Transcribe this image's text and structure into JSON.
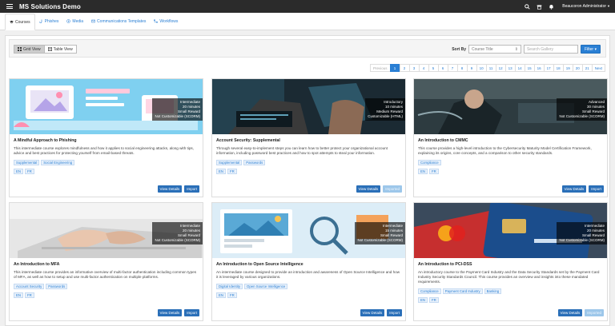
{
  "app": {
    "title": "MS Solutions Demo",
    "user": "Beaucoron Administrator"
  },
  "tabs": [
    {
      "label": "Courses",
      "icon": "graduation-cap-icon"
    },
    {
      "label": "Phishes",
      "icon": "hook-icon"
    },
    {
      "label": "Media",
      "icon": "media-icon"
    },
    {
      "label": "Communications Templates",
      "icon": "envelope-icon"
    },
    {
      "label": "Workflows",
      "icon": "workflow-icon"
    }
  ],
  "toolbar": {
    "grid_view": "Grid View",
    "table_view": "Table View",
    "sort_by": "Sort By",
    "sort_value": "Course Title",
    "search_placeholder": "Search Gallery",
    "filter": "Filter"
  },
  "pagination": {
    "previous": "Previous",
    "next": "Next",
    "pages": [
      "1",
      "2",
      "3",
      "4",
      "5",
      "6",
      "7",
      "8",
      "9",
      "10",
      "11",
      "12",
      "13",
      "14",
      "15",
      "16",
      "17",
      "18",
      "19",
      "20",
      "21"
    ],
    "active": "1"
  },
  "courses": [
    {
      "title": "A Mindful Approach to Phishing",
      "level": "Intermediate",
      "duration": "20 minutes",
      "reward": "Small Reward",
      "custom": "Not Customizable (SCORM)",
      "desc": "This intermediate course explores mindfulness and how it applies to social engineering attacks, along with tips, advice and best practices for protecting yourself from email-based threats.",
      "tags": [
        "Supplemental",
        "Social Engineering"
      ],
      "langs": [
        "EN",
        "FR"
      ],
      "details": "View Details",
      "import": "Import",
      "import_disabled": false
    },
    {
      "title": "Account Security: Supplemental",
      "level": "Introductory",
      "duration": "10 minutes",
      "reward": "Medium Reward",
      "custom": "Customizable (HTML)",
      "desc": "Through several easy-to-implement steps you can learn how to better protect your organizational account information, including password best practices and how to spot attempts to steal your information.",
      "tags": [
        "Supplemental",
        "Passwords"
      ],
      "langs": [
        "EN",
        "FR"
      ],
      "details": "View Details",
      "import": "Imported",
      "import_disabled": true
    },
    {
      "title": "An Introduction to CMMC",
      "level": "Advanced",
      "duration": "30 minutes",
      "reward": "Small Reward",
      "custom": "Not Customizable (SCORM)",
      "desc": "This course provides a high-level introduction to the Cybersecurity Maturity Model Certification Framework, explaining its origins, core concepts, and a comparison to other security standards.",
      "tags": [
        "Compliance"
      ],
      "langs": [
        "EN",
        "FR"
      ],
      "details": "View Details",
      "import": "Import",
      "import_disabled": false
    },
    {
      "title": "An Introduction to MFA",
      "level": "Intermediate",
      "duration": "20 minutes",
      "reward": "Small Reward",
      "custom": "Not Customizable (SCORM)",
      "desc": "This intermediate course provides an informative overview of multi-factor authentication including common types of MFA, as well as how to setup and use multi-factor authentication on multiple platforms.",
      "tags": [
        "Account Security",
        "Passwords"
      ],
      "langs": [
        "EN",
        "FR"
      ],
      "details": "View Details",
      "import": "Import",
      "import_disabled": false
    },
    {
      "title": "An Introduction to Open Source Intelligence",
      "level": "Intermediate",
      "duration": "15 minutes",
      "reward": "Small Reward",
      "custom": "Not Customizable (SCORM)",
      "desc": "An intermediate course designed to provide an introduction and awareness of Open Source Intelligence and how it is leveraged by various organizations.",
      "tags": [
        "Digital Identity",
        "Open Source Intelligence"
      ],
      "langs": [
        "EN",
        "FR"
      ],
      "details": "View Details",
      "import": "Import",
      "import_disabled": false
    },
    {
      "title": "An Introduction to PCI-DSS",
      "level": "Intermediate",
      "duration": "20 minutes",
      "reward": "Small Reward",
      "custom": "Not Customizable (SCORM)",
      "desc": "An introductory course to the Payment Card Industry and the Data Security Standards set by the Payment Card Industry Security Standards Council. This course provides an overview and insights into these mandated requirements.",
      "tags": [
        "Compliance",
        "Payment Card Industry",
        "Banking"
      ],
      "langs": [
        "EN",
        "FR"
      ],
      "details": "View Details",
      "import": "Imported",
      "import_disabled": true
    }
  ]
}
